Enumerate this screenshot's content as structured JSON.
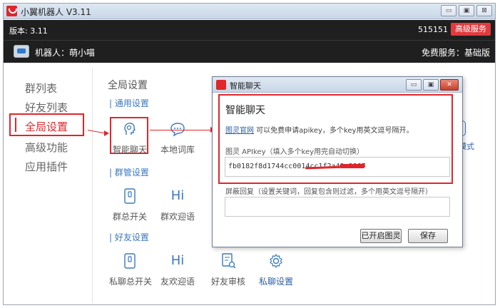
{
  "window": {
    "title": "小翼机器人 V3.11",
    "btn_min": "▭",
    "btn_max": "▣",
    "btn_close": "⊠"
  },
  "header": {
    "version": "版本: 3.11",
    "user_id": "515151",
    "premium_label": "高级服务",
    "bot_label": "机器人：萌小喵",
    "free_service": "免费服务：基础版"
  },
  "sidebar": {
    "items": [
      "群列表",
      "好友列表",
      "全局设置",
      "高级功能",
      "应用插件"
    ],
    "active": "全局设置"
  },
  "main": {
    "title": "全局设置",
    "sections": [
      "| 通用设置",
      "| 群管设置",
      "| 好友设置"
    ],
    "general_tiles": [
      "智能聊天",
      "本地词库"
    ],
    "group_tiles": [
      "群总开关",
      "群欢迎语"
    ],
    "friend_tiles": [
      "私聊总开关",
      "友欢迎语",
      "好友审核",
      "私聊设置"
    ],
    "hi_glyph": "Hi",
    "partial_mode_label": "模式"
  },
  "dialog": {
    "title": "智能聊天",
    "heading": "智能聊天",
    "link_text": "图灵官网",
    "info_text": " 可以免费申请apikey，多个key用英文逗号隔开。",
    "apikey_label": "图灵 APIkey（填入多个key用完自动切换）",
    "apikey_value": "fb0182f8d1744cc0014cc1f2a49c9867",
    "block_label": "屏蔽回复（设置关键词，回复包含则过滤，多个用英文逗号隔开）",
    "block_value": "",
    "enabled_button": "已开启图灵",
    "save_button": "保存",
    "btn_min": "▭",
    "btn_max": "▣",
    "btn_close": "✕"
  },
  "colors": {
    "accent": "#e0262b",
    "link": "#2b5da8",
    "header_bg": "#1f1f1f"
  }
}
